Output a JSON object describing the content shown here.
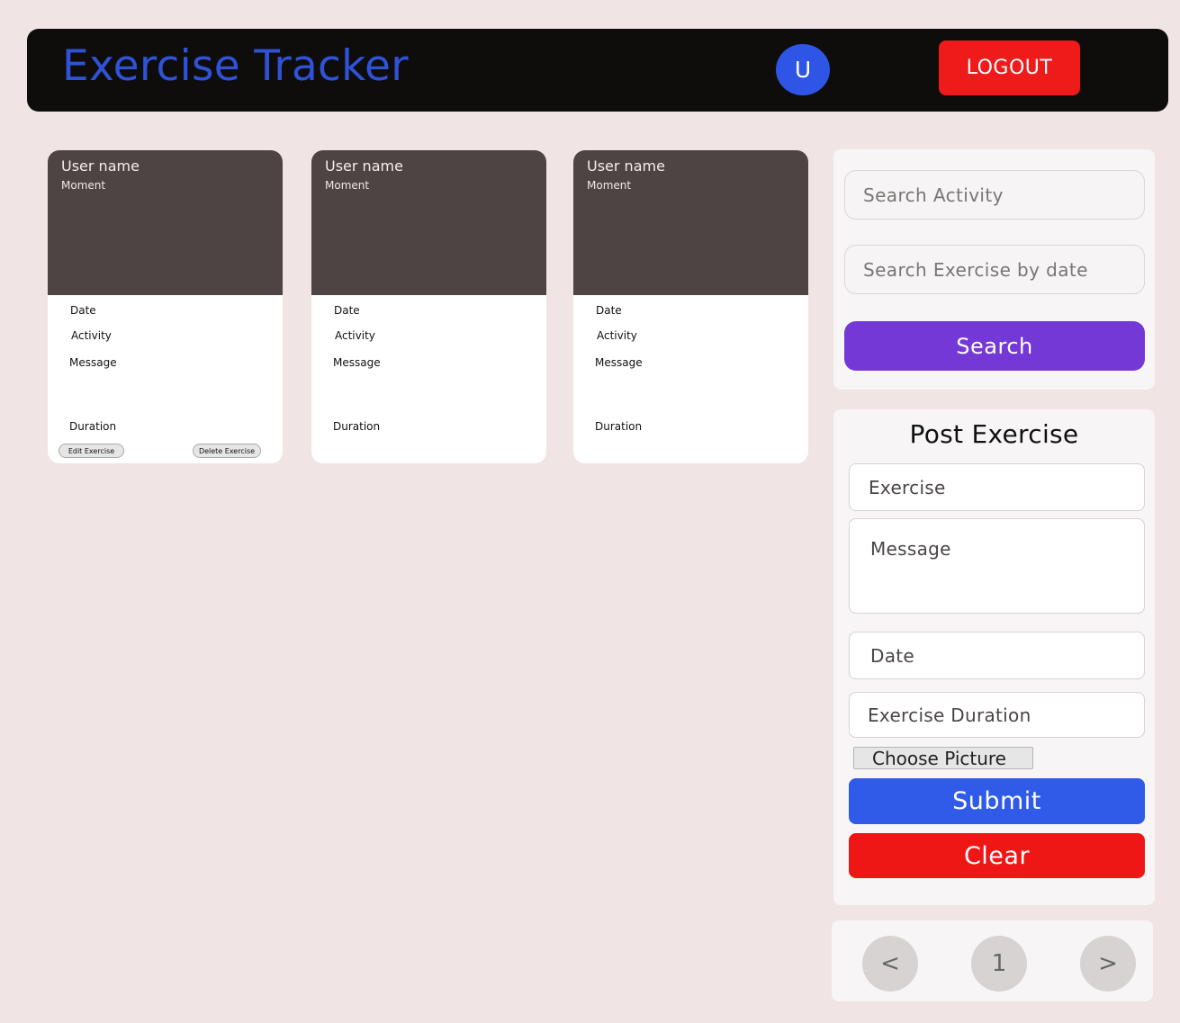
{
  "header": {
    "app_title": "Exercise Tracker",
    "avatar_initial": "U",
    "logout_label": "LOGOUT"
  },
  "cards": [
    {
      "user": "User name",
      "moment": "Moment",
      "date_label": "Date",
      "activity_label": "Activity",
      "message_label": "Message",
      "duration_label": "Duration",
      "edit_label": "Edit Exercise",
      "delete_label": "Delete Exercise"
    },
    {
      "user": "User name",
      "moment": "Moment",
      "date_label": "Date",
      "activity_label": "Activity",
      "message_label": "Message",
      "duration_label": "Duration"
    },
    {
      "user": "User name",
      "moment": "Moment",
      "date_label": "Date",
      "activity_label": "Activity",
      "message_label": "Message",
      "duration_label": "Duration"
    }
  ],
  "search": {
    "activity_placeholder": "Search Activity",
    "date_placeholder": "Search Exercise by date",
    "button_label": "Search"
  },
  "post": {
    "title": "Post Exercise",
    "exercise_placeholder": "Exercise",
    "message_placeholder": "Message",
    "date_placeholder": "Date",
    "duration_placeholder": "Exercise Duration",
    "choose_picture_label": "Choose Picture",
    "submit_label": "Submit",
    "clear_label": "Clear"
  },
  "pagination": {
    "prev_label": "<",
    "current_page": "1",
    "next_label": ">"
  },
  "colors": {
    "background": "#f0e4e4",
    "header_bg": "#0e0d0c",
    "title_blue": "#2f52d8",
    "logout_red": "#ef1a1a",
    "search_purple": "#7338d6",
    "submit_blue": "#2f5be8",
    "clear_red": "#ef1616",
    "card_image_bg": "#4d4443"
  }
}
